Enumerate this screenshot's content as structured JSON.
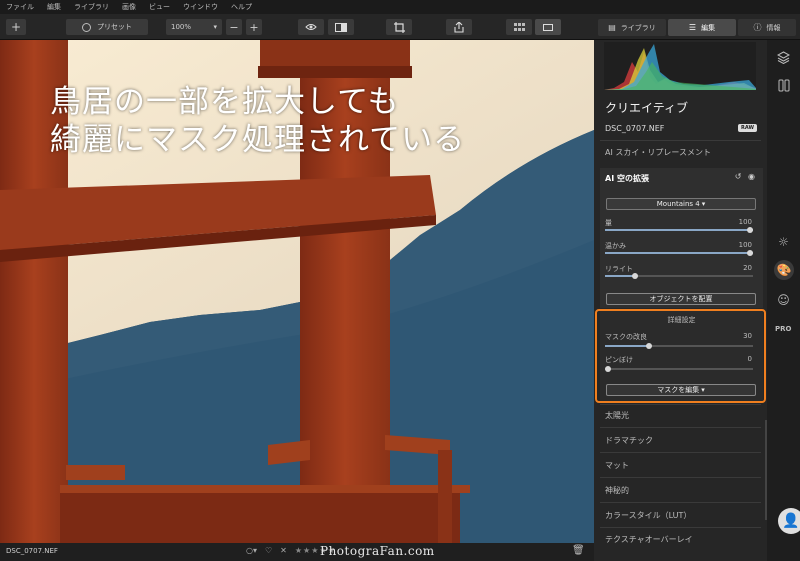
{
  "menubar": [
    "ファイル",
    "編集",
    "ライブラリ",
    "画像",
    "ビュー",
    "ウインドウ",
    "ヘルプ"
  ],
  "toolbar": {
    "add_label": "+",
    "preset_label": "プリセット",
    "zoom_value": "100%",
    "zoom_minus": "−",
    "zoom_plus": "+",
    "tab_library": "ライブラリ",
    "tab_edit": "編集",
    "tab_info": "情報"
  },
  "overlay": {
    "line1": "鳥居の一部を拡大しても",
    "line2": "綺麗にマスク処理されている"
  },
  "panel": {
    "section_title": "クリエイティブ",
    "filename": "DSC_0707.NEF",
    "raw_badge": "RAW",
    "sky_replace": "AI スカイ・リプレースメント",
    "sky_extend": {
      "title": "AI 空の拡張",
      "preset": "Mountains 4",
      "sliders": [
        {
          "label": "量",
          "value": 100
        },
        {
          "label": "温かみ",
          "value": 100
        },
        {
          "label": "リライト",
          "value": 20
        }
      ],
      "place_object": "オブジェクトを配置"
    },
    "advanced": {
      "title": "詳細設定",
      "sliders": [
        {
          "label": "マスクの改良",
          "value": 30
        },
        {
          "label": "ピンぼけ",
          "value": 0
        }
      ],
      "edit_mask": "マスクを編集"
    },
    "tools": [
      "太陽光",
      "ドラマチック",
      "マット",
      "神秘的",
      "カラースタイル（LUT）",
      "テクスチャオーバーレイ"
    ]
  },
  "strip": {
    "pro_label": "PRO"
  },
  "bottombar": {
    "filename": "DSC_0707.NEF",
    "watermark": "PhotograFan.com"
  },
  "colors": {
    "accent": "#f07f1f",
    "torii": "#a83a1c",
    "sky": "#2c4f6c"
  }
}
